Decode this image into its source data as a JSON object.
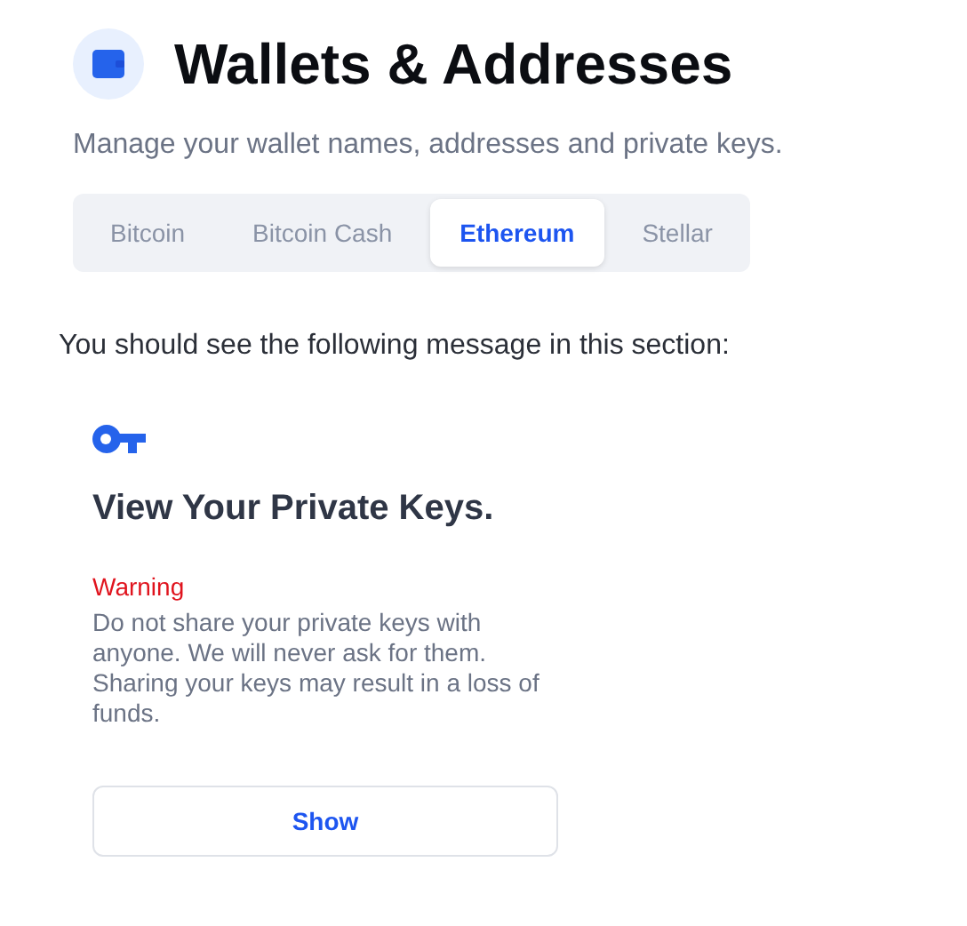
{
  "header": {
    "title": "Wallets & Addresses",
    "subtitle": "Manage your wallet names, addresses and private keys."
  },
  "tabs": [
    {
      "label": "Bitcoin",
      "selected": false
    },
    {
      "label": "Bitcoin Cash",
      "selected": false
    },
    {
      "label": "Ethereum",
      "selected": true
    },
    {
      "label": "Stellar",
      "selected": false
    }
  ],
  "instruction": "You should see the following message in this section:",
  "card": {
    "heading": "View Your Private Keys.",
    "warning_label": "Warning",
    "warning_text": "Do not share your private keys with anyone. We will never ask for them. Sharing your keys may result in a loss of funds.",
    "button": "Show"
  }
}
